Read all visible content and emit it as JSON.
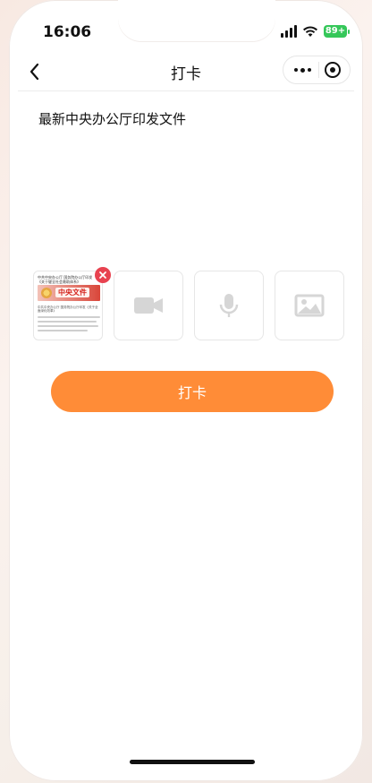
{
  "status_bar": {
    "time": "16:06",
    "battery": "89+",
    "icons": [
      "signal-icon",
      "wifi-icon",
      "battery-icon"
    ]
  },
  "navbar": {
    "title": "打卡",
    "back_icon": "chevron-left-icon",
    "more_icon": "more-icon",
    "target_icon": "target-icon"
  },
  "post": {
    "text": "最新中央办公厅印发文件"
  },
  "media": {
    "thumbnail": {
      "headline": "中共中央办公厅 国务院办公厅印发《关于健全社会救助体系》",
      "banner": "中央文件",
      "subline": "中共中央办公厅 国务院办公厅印发《关于全面深化改革》"
    },
    "delete_icon": "close-icon",
    "slots": [
      {
        "name": "video",
        "icon": "video-camera-icon"
      },
      {
        "name": "audio",
        "icon": "microphone-icon"
      },
      {
        "name": "image",
        "icon": "image-icon"
      }
    ]
  },
  "actions": {
    "punch_label": "打卡"
  },
  "colors": {
    "accent": "#ff8c37",
    "delete": "#e84250",
    "battery": "#35c759"
  }
}
